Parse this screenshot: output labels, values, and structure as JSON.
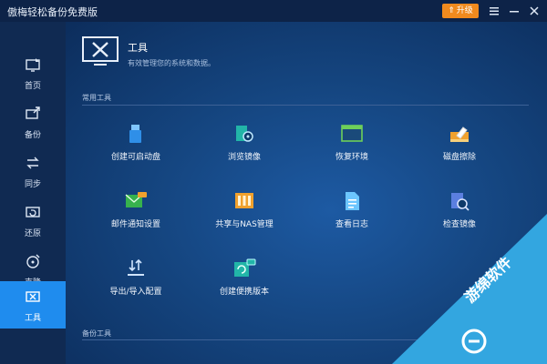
{
  "app": {
    "title": "傲梅轻松备份免费版",
    "upgrade_label": "升级"
  },
  "colors": {
    "accent": "#1f8cee",
    "upgrade": "#f08a1e",
    "sidebar": "#102a52",
    "titlebar": "#0d2348"
  },
  "sidebar": {
    "items": [
      {
        "label": "首页",
        "icon": "home-icon"
      },
      {
        "label": "备份",
        "icon": "backup-icon"
      },
      {
        "label": "同步",
        "icon": "sync-icon"
      },
      {
        "label": "还原",
        "icon": "restore-icon"
      },
      {
        "label": "克隆",
        "icon": "clone-icon"
      },
      {
        "label": "工具",
        "icon": "tools-icon",
        "active": true
      }
    ]
  },
  "page": {
    "title": "工具",
    "subtitle": "有效管理您的系统和数据。"
  },
  "sections": {
    "common": "常用工具",
    "backup": "备份工具"
  },
  "tools": [
    {
      "label": "创建可启动盘",
      "icon": "usb-drive-icon"
    },
    {
      "label": "浏览镜像",
      "icon": "explore-image-icon"
    },
    {
      "label": "恢复环境",
      "icon": "recovery-env-icon"
    },
    {
      "label": "磁盘擦除",
      "icon": "disk-wipe-icon"
    },
    {
      "label": "邮件通知设置",
      "icon": "email-icon"
    },
    {
      "label": "共享与NAS管理",
      "icon": "nas-icon"
    },
    {
      "label": "查看日志",
      "icon": "log-icon"
    },
    {
      "label": "检查镜像",
      "icon": "check-image-icon"
    },
    {
      "label": "导出/导入配置",
      "icon": "export-import-icon"
    },
    {
      "label": "创建便携版本",
      "icon": "portable-icon"
    }
  ],
  "watermark": {
    "text": "游绵软件"
  }
}
